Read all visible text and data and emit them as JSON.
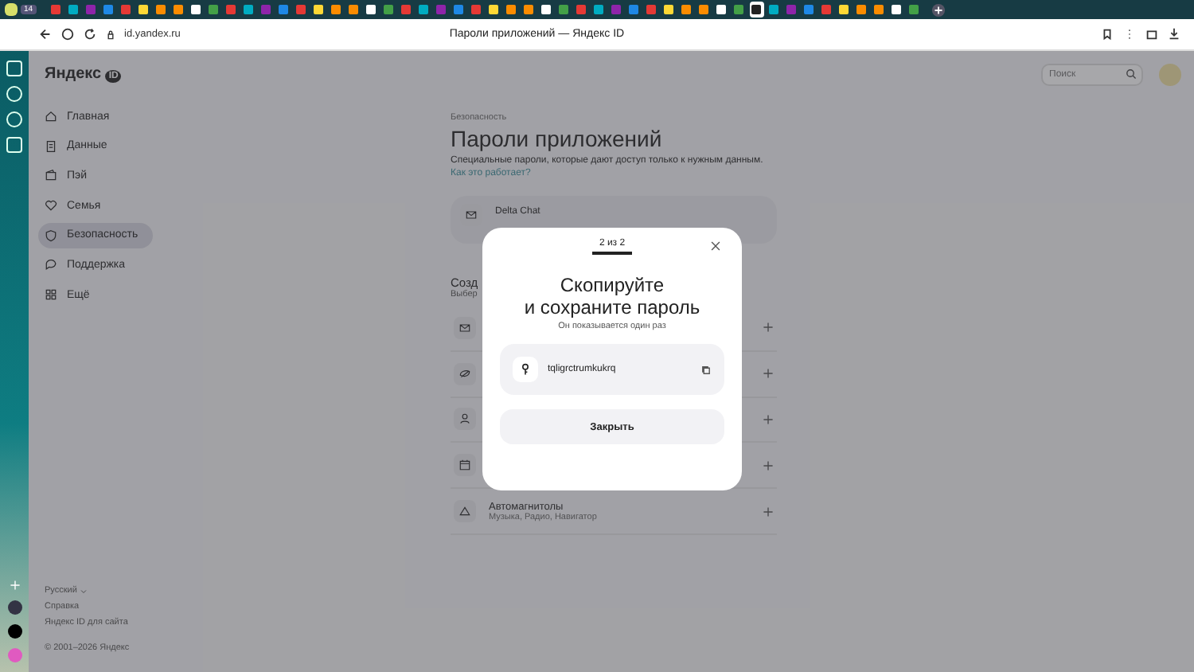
{
  "browser": {
    "url": "id.yandex.ru",
    "page_title": "Пароли приложений — Яндекс ID",
    "tab_count": "14"
  },
  "header": {
    "logo": "Яндекс",
    "logo_badge": "ID",
    "search": {
      "placeholder": "Поиск"
    }
  },
  "nav": [
    {
      "label": "Главная",
      "selected": false
    },
    {
      "label": "Данные",
      "selected": false
    },
    {
      "label": "Пэй",
      "selected": false
    },
    {
      "label": "Семья",
      "selected": false
    },
    {
      "label": "Безопасность",
      "selected": true
    },
    {
      "label": "Поддержка",
      "selected": false
    },
    {
      "label": "Ещё",
      "selected": false
    }
  ],
  "footer": {
    "language": "Русский",
    "links": [
      "Справка",
      "Яндекс ID для сайта"
    ],
    "copyright": "© 2001–2026 Яндекс"
  },
  "main": {
    "breadcrumb": "Безопасность",
    "title": "Пароли приложений",
    "description": "Специальные пароли, которые дают доступ только к нужным данным.",
    "help_link": "Как это работает?",
    "existing": [
      {
        "name": "Delta Chat"
      }
    ],
    "create_heading": "Созд",
    "create_hint": "Выбер",
    "create_rows": [
      {
        "title": "Автомагнитолы",
        "subtitle": "Музыка, Радио, Навигатор"
      }
    ]
  },
  "modal": {
    "step": "2 из 2",
    "title_lines": [
      "Скопируйте",
      "и сохраните пароль"
    ],
    "subtitle": "Он показывается один раз",
    "password": "tqligrctrumkukrq",
    "close_button": "Закрыть"
  }
}
